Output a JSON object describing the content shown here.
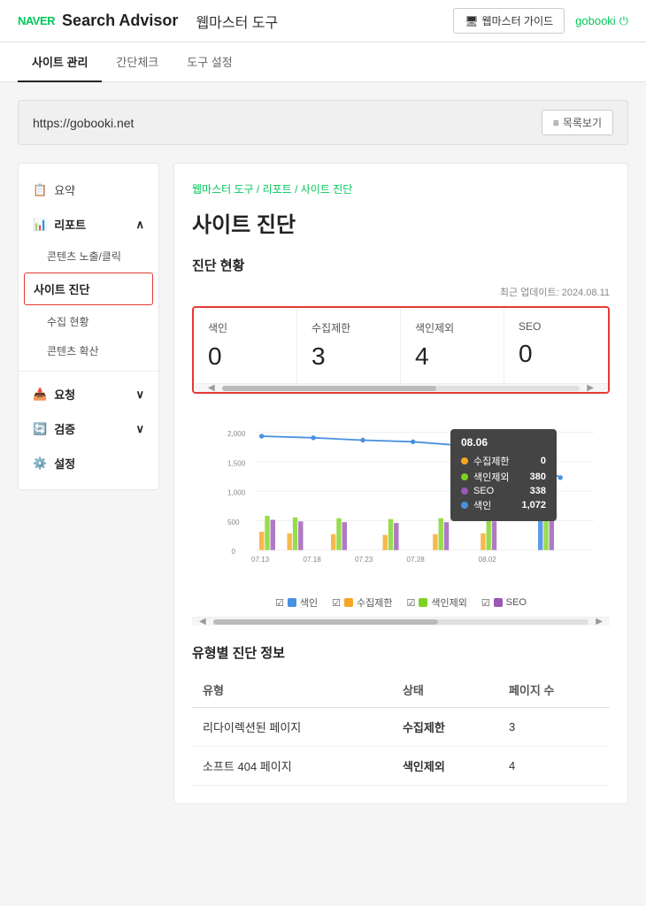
{
  "header": {
    "naver_logo": "NAVER",
    "title": "Search Advisor",
    "subtitle": "웹마스터 도구",
    "guide_btn": "웹마스터 가이드",
    "user": "gobooki"
  },
  "nav": {
    "tabs": [
      {
        "label": "사이트 관리",
        "active": true
      },
      {
        "label": "간단체크",
        "active": false
      },
      {
        "label": "도구 설정",
        "active": false
      }
    ]
  },
  "site_bar": {
    "url": "https://gobooki.net",
    "list_btn": "목록보기"
  },
  "sidebar": {
    "items": [
      {
        "id": "summary",
        "label": "요약",
        "icon": "📋",
        "type": "item"
      },
      {
        "id": "report",
        "label": "리포트",
        "icon": "📊",
        "type": "section",
        "expanded": true
      },
      {
        "id": "contents-exposure",
        "label": "콘텐츠 노출/클릭",
        "type": "sub"
      },
      {
        "id": "site-diagnosis",
        "label": "사이트 진단",
        "type": "sub",
        "highlighted": true
      },
      {
        "id": "collection",
        "label": "수집 현황",
        "type": "sub"
      },
      {
        "id": "content-expansion",
        "label": "콘텐츠 확산",
        "type": "sub"
      },
      {
        "id": "request",
        "label": "요청",
        "icon": "📥",
        "type": "section"
      },
      {
        "id": "verification",
        "label": "검증",
        "icon": "🔄",
        "type": "section"
      },
      {
        "id": "settings",
        "label": "설정",
        "icon": "⚙️",
        "type": "section"
      }
    ]
  },
  "main": {
    "breadcrumb": {
      "parts": [
        "웹마스터 도구",
        "리포트",
        "사이트 진단"
      ],
      "active": "사이트 진단"
    },
    "page_title": "사이트 진단",
    "last_update": "최근 업데이트: 2024.08.11",
    "diagnosis_section": "진단 현황",
    "stats": [
      {
        "label": "색인",
        "value": "0"
      },
      {
        "label": "수집제한",
        "value": "3"
      },
      {
        "label": "색인제외",
        "value": "4"
      },
      {
        "label": "SEO",
        "value": "0"
      }
    ],
    "chart": {
      "y_labels": [
        "2,000",
        "1,500",
        "1,000",
        "500",
        "0"
      ],
      "x_labels": [
        "07.13",
        "07.18",
        "07.23",
        "07.28",
        "08.02"
      ],
      "tooltip": {
        "date": "08.06",
        "rows": [
          {
            "label": "수집제한",
            "value": "0",
            "color": "#f5a623"
          },
          {
            "label": "색인제외",
            "value": "380",
            "color": "#7ed321"
          },
          {
            "label": "SEO",
            "value": "338",
            "color": "#4a90e2"
          },
          {
            "label": "색인",
            "value": "1,072",
            "color": "#4a90e2"
          }
        ]
      },
      "legend": [
        {
          "label": "색인",
          "color": "#4a90e2"
        },
        {
          "label": "수집제한",
          "color": "#f5a623"
        },
        {
          "label": "색인제외",
          "color": "#7ed321"
        },
        {
          "label": "SEO",
          "color": "#9b59b6"
        }
      ]
    },
    "type_section": "유형별 진단 정보",
    "type_table": {
      "headers": [
        "유형",
        "상태",
        "페이지 수"
      ],
      "rows": [
        {
          "type": "리다이렉션된 페이지",
          "status": "수집제한",
          "status_color": "orange",
          "pages": "3"
        },
        {
          "type": "소프트 404 페이지",
          "status": "색인제외",
          "status_color": "blue",
          "pages": "4"
        }
      ]
    }
  }
}
